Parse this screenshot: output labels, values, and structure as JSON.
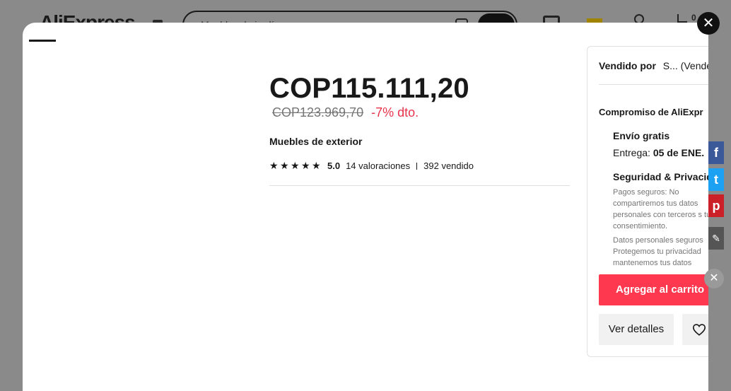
{
  "background": {
    "logo": "AliExpress",
    "search_placeholder": "Muebles de jardín",
    "cart_count": "0"
  },
  "modal": {
    "close_icon": "close-icon",
    "price_current": "COP115.111,20",
    "price_original": "COP123.969,70",
    "discount": "-7% dto.",
    "title": "Muebles de exterior",
    "rating": {
      "stars": 5,
      "score": "5.0",
      "reviews": "14 valoraciones",
      "sold": "392 vendido"
    }
  },
  "panel": {
    "seller_label": "Vendido por",
    "seller_name": "S... (Vende",
    "commitment_title": "Compromiso de AliExpr",
    "shipping_title": "Envío gratis",
    "delivery_label": "Entrega:",
    "delivery_date": "05 de ENE.",
    "security_title": "Seguridad & Privacid",
    "security_text_1": "Pagos seguros: No compartiremos tus datos personales con terceros s tu consentimiento.",
    "security_text_2": "Datos personales seguros Protegemos tu privacidad mantenemos tus datos",
    "add_to_cart": "Agregar al carrito",
    "view_details": "Ver detalles"
  },
  "share": {
    "facebook": "f",
    "twitter": "t",
    "pinterest": "p",
    "edit": "✎",
    "close": "✕"
  },
  "colors": {
    "accent": "#fd384f",
    "discount": "#e8344b",
    "facebook": "#3b5998",
    "twitter": "#1da1f2",
    "pinterest": "#cb2027"
  }
}
